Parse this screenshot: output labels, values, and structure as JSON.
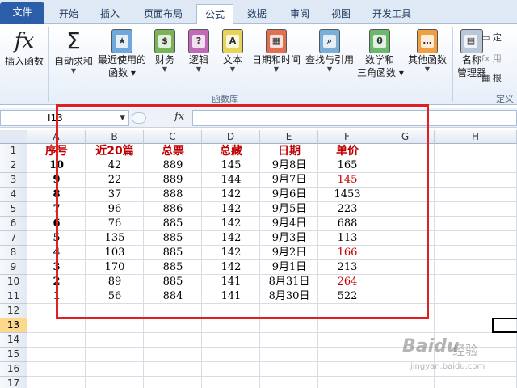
{
  "tabs": {
    "file": "文件",
    "home": "开始",
    "insert": "插入",
    "page_layout": "页面布局",
    "formulas": "公式",
    "data": "数据",
    "review": "审阅",
    "view": "视图",
    "developer": "开发工具"
  },
  "ribbon": {
    "insert_function": "插入函数",
    "autosum": "自动求和",
    "recent_line1": "最近使用的",
    "recent_line2": "函数",
    "financial": "财务",
    "logical": "逻辑",
    "text": "文本",
    "datetime": "日期和时间",
    "lookup": "查找与引用",
    "math_line1": "数学和",
    "math_line2": "三角函数",
    "more": "其他函数",
    "name_mgr_line1": "名称",
    "name_mgr_line2": "管理器",
    "group_library": "函数库",
    "group_defined": "定义",
    "side_define": "定",
    "side_use": "用",
    "side_create": "根"
  },
  "formula_bar": {
    "name_box": "I13",
    "fx_label": "fx",
    "formula": ""
  },
  "columns": [
    "A",
    "B",
    "C",
    "D",
    "E",
    "F",
    "G",
    "H"
  ],
  "rows": [
    "1",
    "2",
    "3",
    "4",
    "5",
    "6",
    "7",
    "8",
    "9",
    "10",
    "11",
    "12",
    "13",
    "14",
    "15",
    "16",
    "17"
  ],
  "active_row": "13",
  "table": {
    "headers": [
      "序号",
      "近20篇",
      "总票",
      "总藏",
      "日期",
      "单价"
    ],
    "rows": [
      [
        "10",
        "42",
        "889",
        "145",
        "9月8日",
        "165"
      ],
      [
        "9",
        "22",
        "889",
        "144",
        "9月7日",
        "145"
      ],
      [
        "8",
        "37",
        "888",
        "142",
        "9月6日",
        "1453"
      ],
      [
        "7",
        "96",
        "886",
        "142",
        "9月5日",
        "223"
      ],
      [
        "6",
        "76",
        "885",
        "142",
        "9月4日",
        "688"
      ],
      [
        "5",
        "135",
        "885",
        "142",
        "9月3日",
        "113"
      ],
      [
        "4",
        "103",
        "885",
        "142",
        "9月2日",
        "166"
      ],
      [
        "3",
        "170",
        "885",
        "142",
        "9月1日",
        "213"
      ],
      [
        "2",
        "89",
        "885",
        "141",
        "8月31日",
        "264"
      ],
      [
        "1",
        "56",
        "884",
        "141",
        "8月30日",
        "522"
      ]
    ],
    "red_price_rows": [
      1,
      6,
      8
    ]
  },
  "watermark": {
    "brand": "Baidu",
    "brand_cn": "经验",
    "url": "jingyan.baidu.com"
  },
  "colors": {
    "header_text": "#c00000",
    "highlight_box": "#e02020",
    "file_tab": "#2a5ea8"
  }
}
